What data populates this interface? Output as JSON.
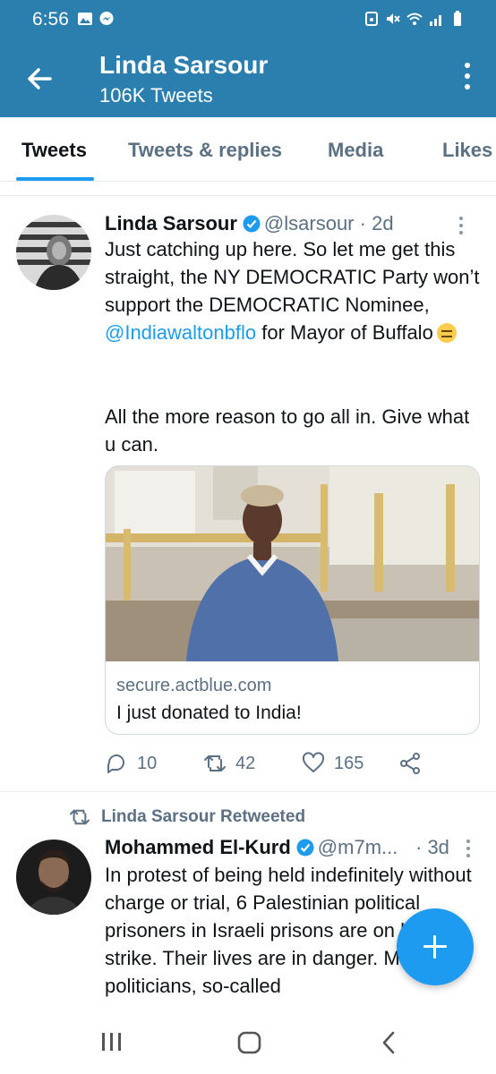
{
  "status_bar": {
    "time": "6:56",
    "left_icons": [
      "gallery-icon",
      "messenger-icon"
    ],
    "right_icons": [
      "alarm-icon",
      "mute-icon",
      "wifi-icon",
      "signal-icon",
      "battery-icon"
    ]
  },
  "header": {
    "back_icon": "arrow-left-icon",
    "title": "Linda Sarsour",
    "subtitle": "106K Tweets",
    "more_icon": "more-vertical-icon"
  },
  "tabs": [
    {
      "label": "Tweets",
      "active": true
    },
    {
      "label": "Tweets & replies",
      "active": false
    },
    {
      "label": "Media",
      "active": false
    },
    {
      "label": "Likes",
      "active": false
    }
  ],
  "tweets": [
    {
      "author_name": "Linda Sarsour",
      "verified": true,
      "handle": "@lsarsour",
      "time": "· 2d",
      "text_1": "Just catching up here. So let me get this straight, the NY DEMOCRATIC Party won’t support the DEMOCRATIC Nominee, ",
      "mention": "@Indiawaltonbflo",
      "text_2": " for Mayor of Buffalo",
      "emoji": "expressionless-face",
      "text_3": "All the more reason to go all in. Give what u can.",
      "card": {
        "domain": "secure.actblue.com",
        "title": "I just donated to India!"
      },
      "actions": {
        "replies": "10",
        "retweets": "42",
        "likes": "165"
      }
    },
    {
      "retweeted_by": "Linda Sarsour Retweeted",
      "author_name": "Mohammed El-Kurd",
      "verified": true,
      "handle": "@m7m...",
      "time": "· 3d",
      "text": "In protest of being held indefinitely without charge or trial, 6 Palestinian political prisoners in Israeli prisons are on hunger strike. Their lives are in danger. Media, politicians, so-called"
    }
  ],
  "fab": {
    "icon": "plus-icon"
  },
  "nav_bar": {
    "icons": [
      "recents-icon",
      "home-icon",
      "back-icon"
    ]
  },
  "colors": {
    "header_bg": "#2a7fae",
    "accent": "#1d9bf0",
    "text_primary": "#0f1419",
    "text_secondary": "#5b7083"
  }
}
